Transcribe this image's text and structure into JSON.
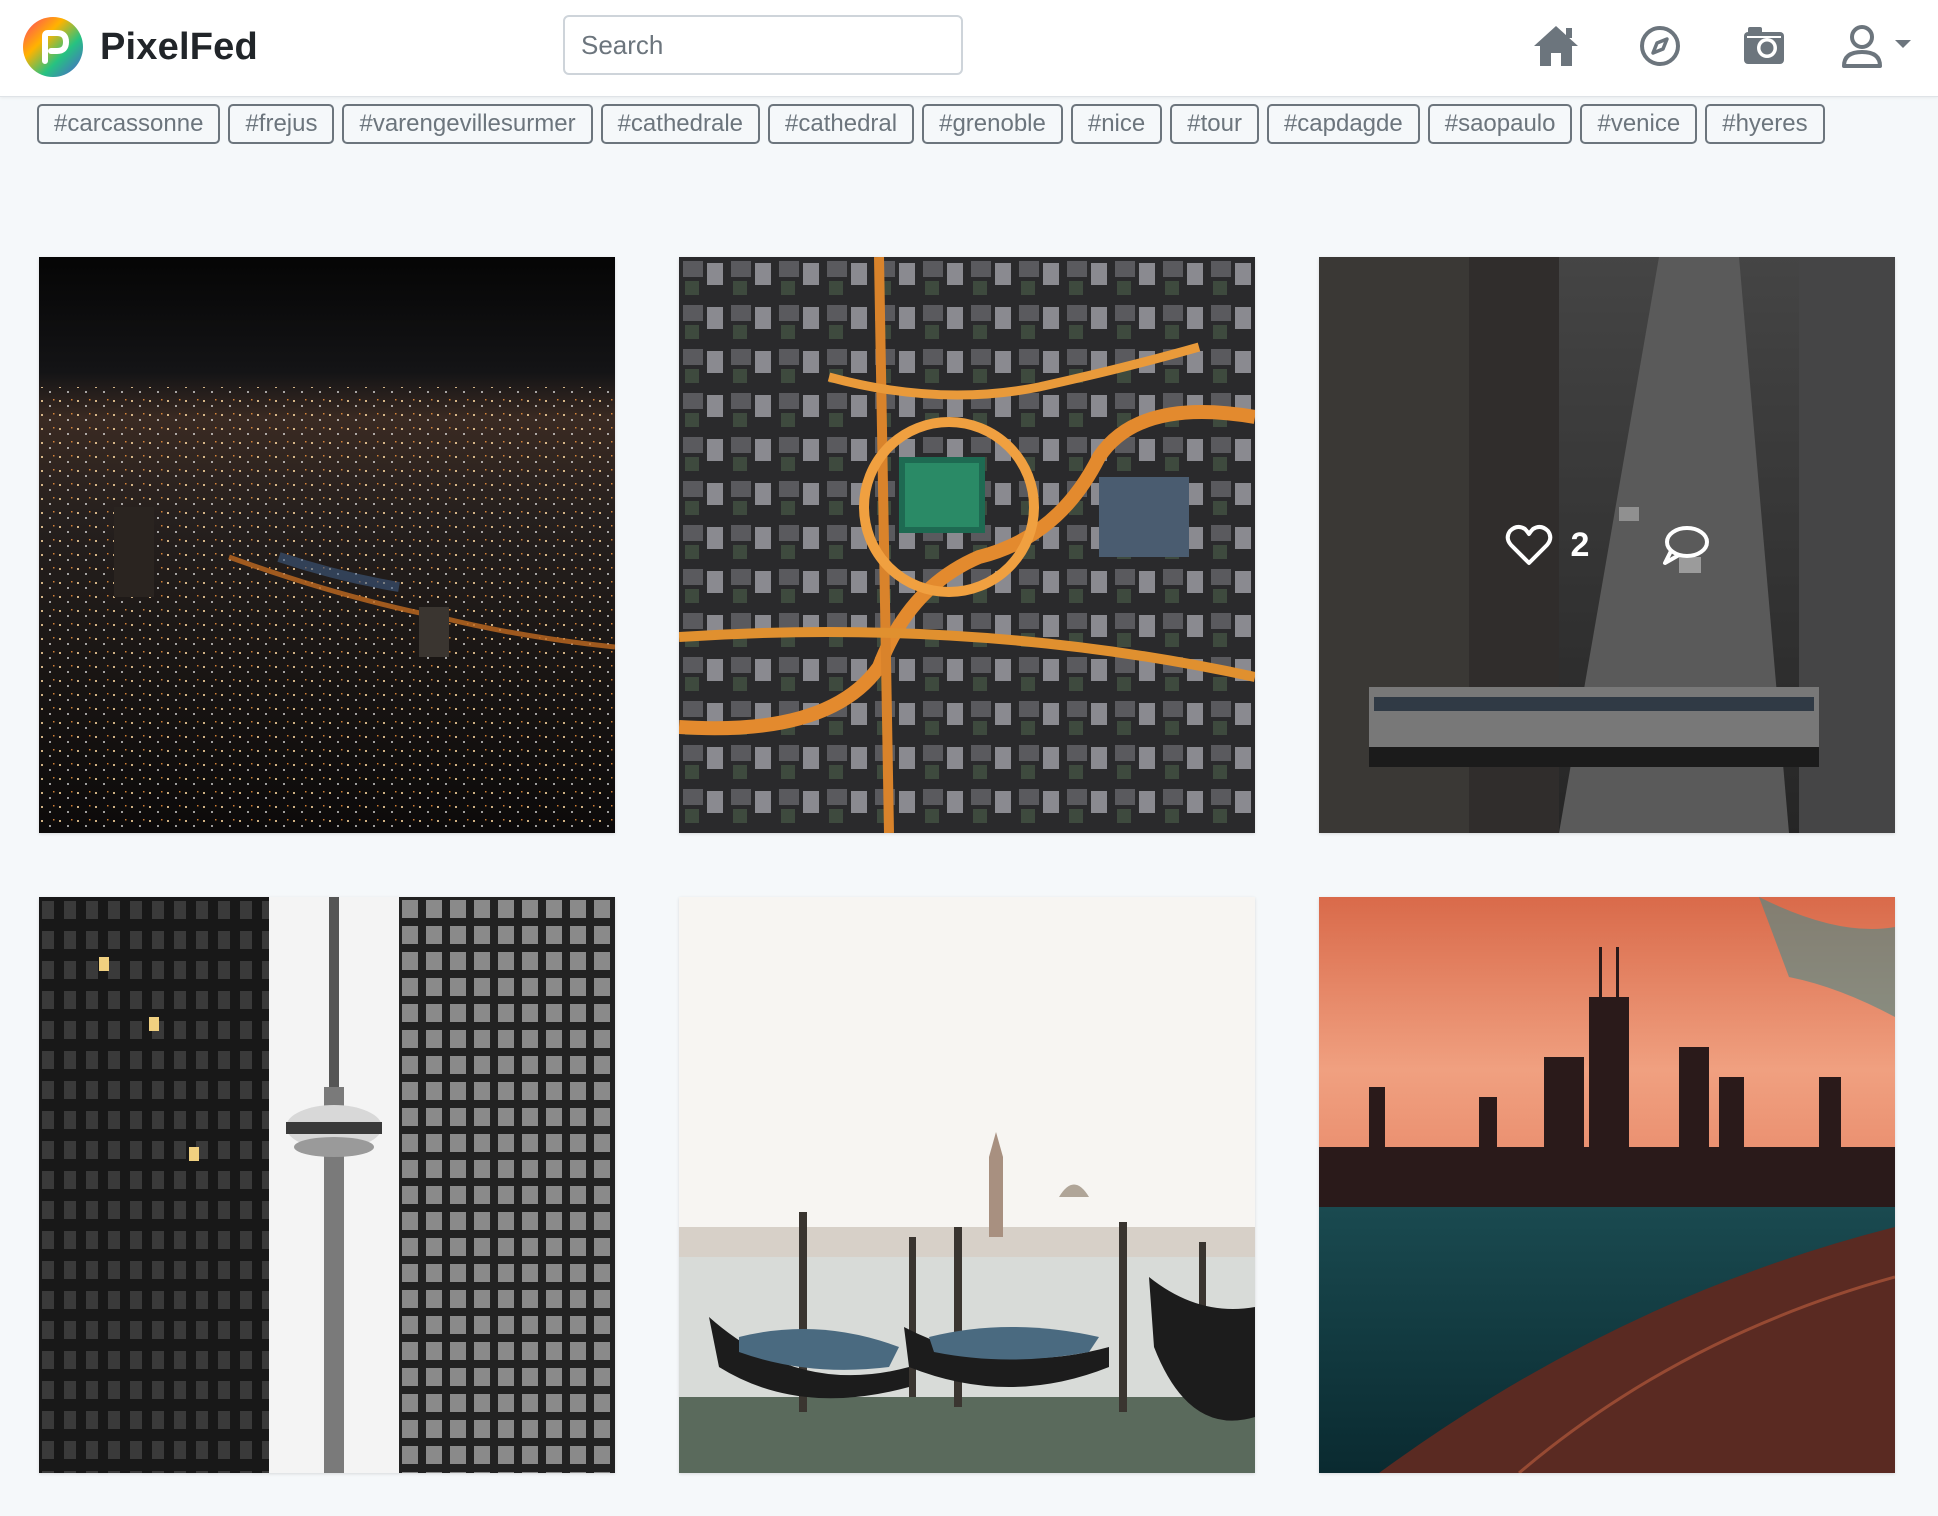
{
  "header": {
    "brand": "PixelFed",
    "search_placeholder": "Search",
    "icons": [
      "home-icon",
      "compass-icon",
      "camera-icon",
      "user-icon"
    ]
  },
  "hashtags": [
    "#carcassonne",
    "#frejus",
    "#varengevillesurmer",
    "#cathedrale",
    "#cathedral",
    "#grenoble",
    "#nice",
    "#tour",
    "#capdagde",
    "#saopaulo",
    "#venice",
    "#hyeres"
  ],
  "posts": [
    {
      "subject": "night-city-aerial"
    },
    {
      "subject": "aerial-intersection-night"
    },
    {
      "subject": "city-street-train",
      "likes": "2",
      "hovered": true
    },
    {
      "subject": "cn-tower-skyscrapers"
    },
    {
      "subject": "venice-gondolas"
    },
    {
      "subject": "chicago-skyline-sunset"
    }
  ],
  "colors": {
    "background": "#f5f8fa",
    "tag_border": "#6c757d",
    "text": "#212529"
  }
}
